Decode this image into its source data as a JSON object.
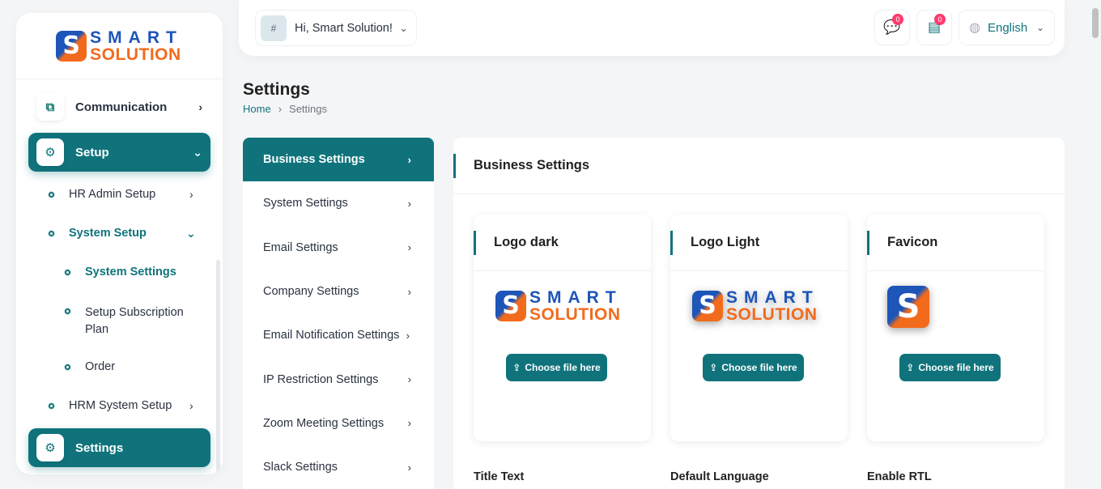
{
  "brand": {
    "line1": "SMART",
    "line2": "SOLUTION",
    "mark": "S"
  },
  "sidebar": {
    "communication": "Communication",
    "setup": "Setup",
    "hr_admin_setup": "HR Admin Setup",
    "system_setup": "System Setup",
    "system_settings": "System Settings",
    "setup_subscription_plan": "Setup Subscription Plan",
    "order": "Order",
    "hrm_system_setup": "HRM System Setup",
    "settings": "Settings"
  },
  "topbar": {
    "avatar_alt": "#",
    "greeting": "Hi, Smart Solution!",
    "messages_count": "0",
    "notifications_count": "0",
    "language": "English"
  },
  "page": {
    "title": "Settings",
    "breadcrumb_home": "Home",
    "breadcrumb_current": "Settings"
  },
  "settings_menu": [
    "Business Settings",
    "System Settings",
    "Email Settings",
    "Company Settings",
    "Email Notification Settings",
    "IP Restriction Settings",
    "Zoom Meeting Settings",
    "Slack Settings"
  ],
  "panel": {
    "title": "Business Settings",
    "cards": [
      {
        "title": "Logo dark",
        "button": "Choose file here"
      },
      {
        "title": "Logo Light",
        "button": "Choose file here"
      },
      {
        "title": "Favicon",
        "button": "Choose file here"
      }
    ],
    "fields": {
      "title_text": "Title Text",
      "default_language": "Default Language",
      "enable_rtl": "Enable RTL"
    }
  },
  "colors": {
    "primary": "#10737c",
    "brand_blue": "#1d55b8",
    "brand_orange": "#f26b1d",
    "badge": "#ff3a6e"
  }
}
